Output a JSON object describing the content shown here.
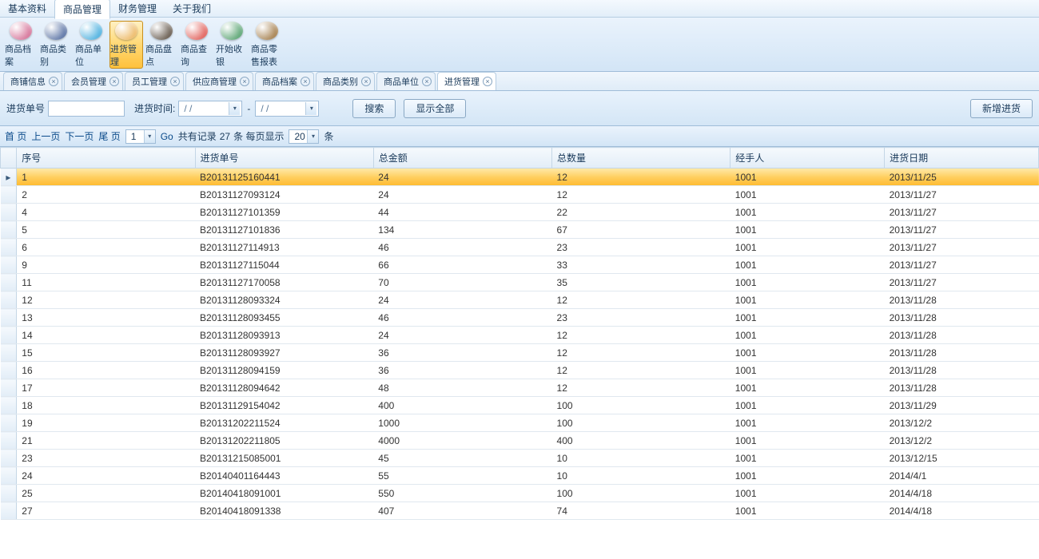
{
  "top_menu": [
    "基本资料",
    "商品管理",
    "财务管理",
    "关于我们"
  ],
  "top_menu_active_index": 1,
  "ribbon": [
    {
      "label": "商品档案",
      "color": "#c94a7a"
    },
    {
      "label": "商品类别",
      "color": "#2a4a8a"
    },
    {
      "label": "商品单位",
      "color": "#1a9ad6"
    },
    {
      "label": "进货管理",
      "color": "#e8a63a"
    },
    {
      "label": "商品盘点",
      "color": "#3a2a1a"
    },
    {
      "label": "商品查询",
      "color": "#d8322a"
    },
    {
      "label": "开始收银",
      "color": "#2a8a4a"
    },
    {
      "label": "商品零售报表",
      "color": "#8a5a1a"
    }
  ],
  "ribbon_active_index": 3,
  "tabs": [
    "商铺信息",
    "会员管理",
    "员工管理",
    "供应商管理",
    "商品档案",
    "商品类别",
    "商品单位",
    "进货管理"
  ],
  "tab_active_index": 7,
  "filter": {
    "order_label": "进货单号",
    "time_label": "进货时间:",
    "date_placeholder": "/    /",
    "dash": "-",
    "search_btn": "搜索",
    "show_all_btn": "显示全部",
    "new_btn": "新增进货"
  },
  "pager": {
    "first": "首 页",
    "prev": "上一页",
    "next": "下一页",
    "last": "尾 页",
    "page_select": "1",
    "go": "Go",
    "total_prefix": "共有记录",
    "total_count": "27",
    "total_suffix": "条 每页显示",
    "page_size": "20",
    "page_size_suffix": "条"
  },
  "table": {
    "columns": [
      "序号",
      "进货单号",
      "总金额",
      "总数量",
      "经手人",
      "进货日期"
    ],
    "selected_row_index": 0,
    "rows": [
      {
        "seq": "1",
        "order": "B20131125160441",
        "amount": "24",
        "qty": "12",
        "emp": "1001",
        "date": "2013/11/25"
      },
      {
        "seq": "2",
        "order": "B20131127093124",
        "amount": "24",
        "qty": "12",
        "emp": "1001",
        "date": "2013/11/27"
      },
      {
        "seq": "4",
        "order": "B20131127101359",
        "amount": "44",
        "qty": "22",
        "emp": "1001",
        "date": "2013/11/27"
      },
      {
        "seq": "5",
        "order": "B20131127101836",
        "amount": "134",
        "qty": "67",
        "emp": "1001",
        "date": "2013/11/27"
      },
      {
        "seq": "6",
        "order": "B20131127114913",
        "amount": "46",
        "qty": "23",
        "emp": "1001",
        "date": "2013/11/27"
      },
      {
        "seq": "9",
        "order": "B20131127115044",
        "amount": "66",
        "qty": "33",
        "emp": "1001",
        "date": "2013/11/27"
      },
      {
        "seq": "11",
        "order": "B20131127170058",
        "amount": "70",
        "qty": "35",
        "emp": "1001",
        "date": "2013/11/27"
      },
      {
        "seq": "12",
        "order": "B20131128093324",
        "amount": "24",
        "qty": "12",
        "emp": "1001",
        "date": "2013/11/28"
      },
      {
        "seq": "13",
        "order": "B20131128093455",
        "amount": "46",
        "qty": "23",
        "emp": "1001",
        "date": "2013/11/28"
      },
      {
        "seq": "14",
        "order": "B20131128093913",
        "amount": "24",
        "qty": "12",
        "emp": "1001",
        "date": "2013/11/28"
      },
      {
        "seq": "15",
        "order": "B20131128093927",
        "amount": "36",
        "qty": "12",
        "emp": "1001",
        "date": "2013/11/28"
      },
      {
        "seq": "16",
        "order": "B20131128094159",
        "amount": "36",
        "qty": "12",
        "emp": "1001",
        "date": "2013/11/28"
      },
      {
        "seq": "17",
        "order": "B20131128094642",
        "amount": "48",
        "qty": "12",
        "emp": "1001",
        "date": "2013/11/28"
      },
      {
        "seq": "18",
        "order": "B20131129154042",
        "amount": "400",
        "qty": "100",
        "emp": "1001",
        "date": "2013/11/29"
      },
      {
        "seq": "19",
        "order": "B20131202211524",
        "amount": "1000",
        "qty": "100",
        "emp": "1001",
        "date": "2013/12/2"
      },
      {
        "seq": "21",
        "order": "B20131202211805",
        "amount": "4000",
        "qty": "400",
        "emp": "1001",
        "date": "2013/12/2"
      },
      {
        "seq": "23",
        "order": "B20131215085001",
        "amount": "45",
        "qty": "10",
        "emp": "1001",
        "date": "2013/12/15"
      },
      {
        "seq": "24",
        "order": "B20140401164443",
        "amount": "55",
        "qty": "10",
        "emp": "1001",
        "date": "2014/4/1"
      },
      {
        "seq": "25",
        "order": "B20140418091001",
        "amount": "550",
        "qty": "100",
        "emp": "1001",
        "date": "2014/4/18"
      },
      {
        "seq": "27",
        "order": "B20140418091338",
        "amount": "407",
        "qty": "74",
        "emp": "1001",
        "date": "2014/4/18"
      }
    ]
  }
}
